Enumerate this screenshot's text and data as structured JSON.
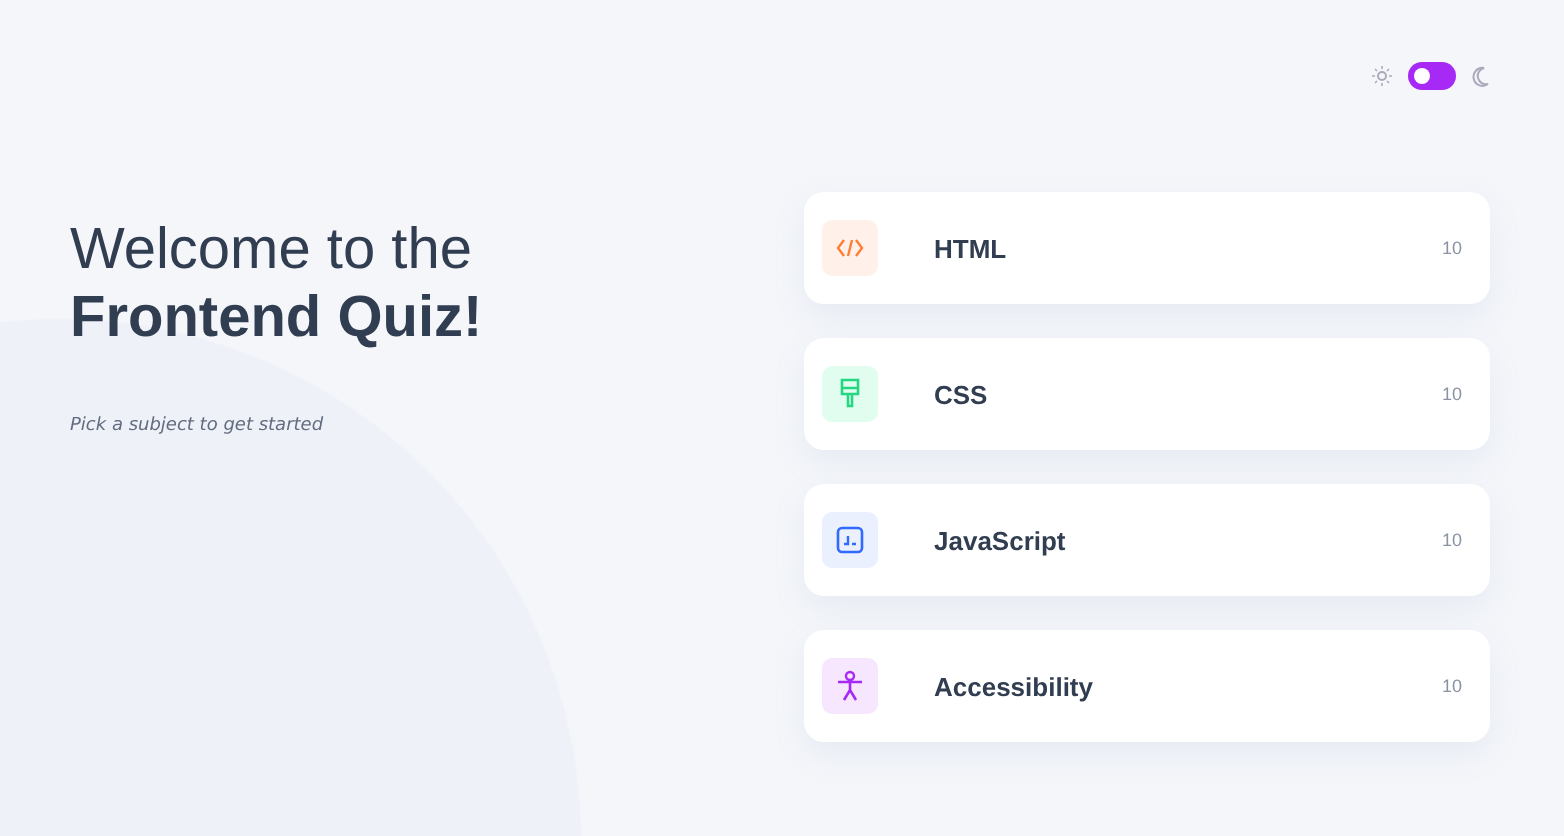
{
  "theme_toggle": {
    "on": false
  },
  "heading": {
    "line_1": "Welcome to the",
    "line_2": "Frontend Quiz!"
  },
  "subtitle": "Pick a subject to get started",
  "subjects": [
    {
      "kind": "html",
      "name": "HTML",
      "count": "10",
      "color": "#fff1e9"
    },
    {
      "kind": "css",
      "name": "CSS",
      "count": "10",
      "color": "#e0fdef"
    },
    {
      "kind": "js",
      "name": "JavaScript",
      "count": "10",
      "color": "#ebf0ff"
    },
    {
      "kind": "a11y",
      "name": "Accessibility",
      "count": "10",
      "color": "#f6e7ff"
    }
  ]
}
